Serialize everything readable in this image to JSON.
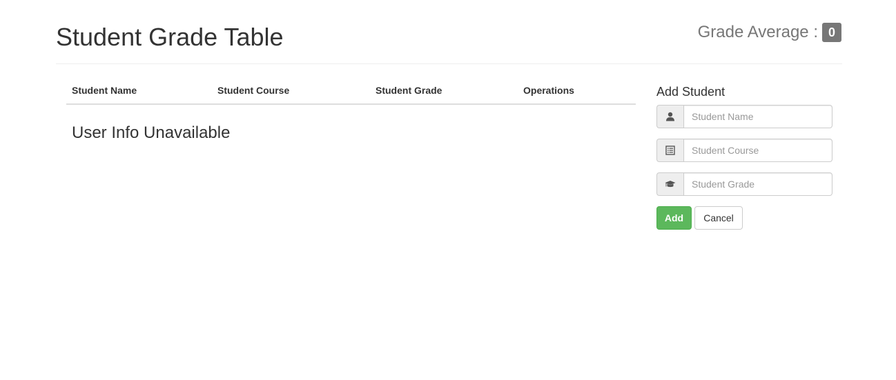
{
  "header": {
    "title": "Student Grade Table",
    "grade_average_label": "Grade Average :",
    "grade_average_value": "0"
  },
  "table": {
    "columns": [
      "Student Name",
      "Student Course",
      "Student Grade",
      "Operations"
    ],
    "empty_message": "User Info Unavailable"
  },
  "form": {
    "title": "Add Student",
    "fields": [
      {
        "placeholder": "Student Name",
        "value": "",
        "icon": "user-icon"
      },
      {
        "placeholder": "Student Course",
        "value": "",
        "icon": "list-alt-icon"
      },
      {
        "placeholder": "Student Grade",
        "value": "",
        "icon": "graduation-cap-icon"
      }
    ],
    "add_label": "Add",
    "cancel_label": "Cancel"
  },
  "colors": {
    "add_button": "#5cb85c",
    "badge": "#777777",
    "text": "#333333"
  }
}
